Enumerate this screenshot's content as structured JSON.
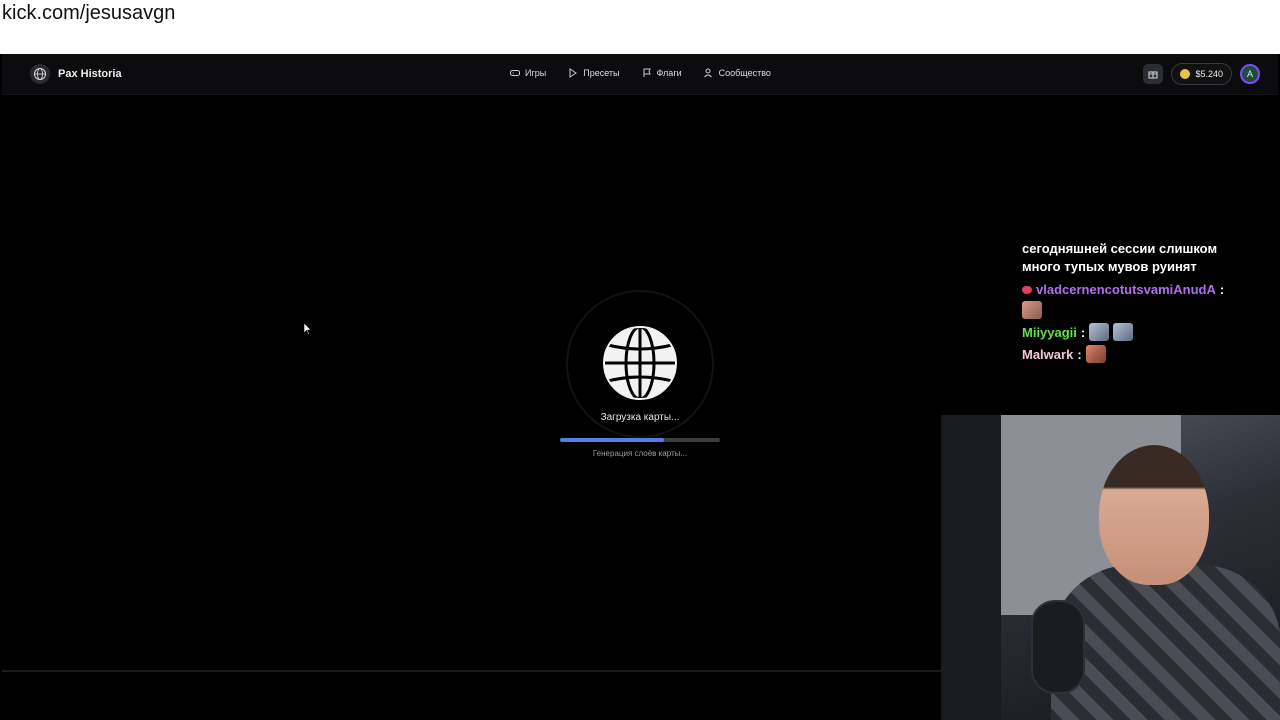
{
  "stream": {
    "url": "kick.com/jesusavgn"
  },
  "navbar": {
    "brand": "Pax Historia",
    "links": [
      {
        "label": "Игры",
        "icon": "gamepad-icon"
      },
      {
        "label": "Пресеты",
        "icon": "play-icon"
      },
      {
        "label": "Флаги",
        "icon": "flag-icon"
      },
      {
        "label": "Сообщество",
        "icon": "users-icon"
      }
    ],
    "balance": "$5.240",
    "avatar_initial": "A"
  },
  "loader": {
    "title": "Загрузка карты...",
    "subtitle": "Генерация слоёв карты...",
    "progress": 0.65,
    "progress_color": "#4f7fe8"
  },
  "chat": {
    "partial_line_1": "сегодняшней сессии слишком",
    "partial_line_2": "много тупых мувов руинят",
    "messages": [
      {
        "user": "vladcernencotutsvamiAnudA",
        "color": "#b26df2"
      },
      {
        "user": "Miiyyagii",
        "color": "#66e04a"
      },
      {
        "user": "Malwark",
        "color": "#f3c6d8"
      }
    ]
  }
}
